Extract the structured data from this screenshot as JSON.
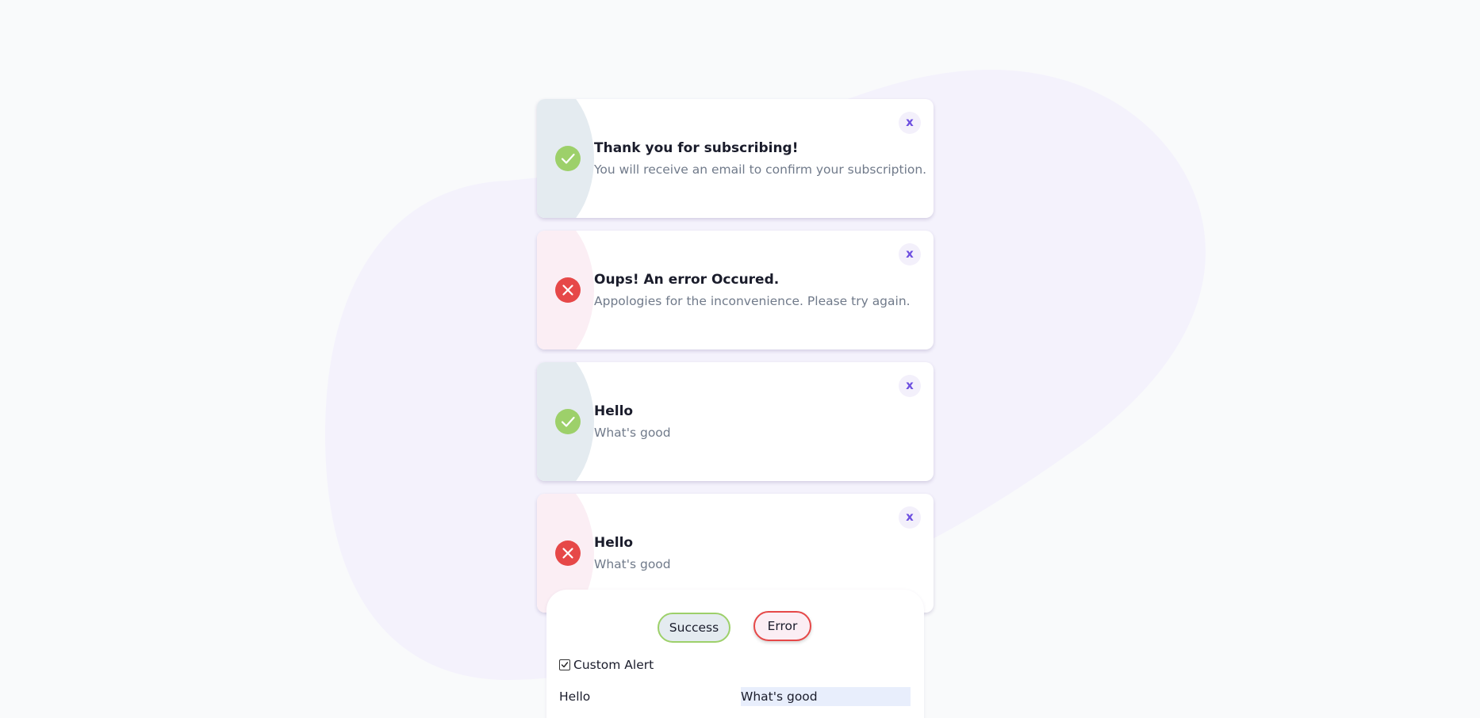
{
  "colors": {
    "background": "#f9fafb",
    "blob": "#f4f2fc",
    "success_icon": "#9dd06a",
    "success_side": "#e4ebf0",
    "error_icon": "#e64848",
    "error_side": "#fbeef4",
    "close_accent": "#6d4fe0"
  },
  "alerts": [
    {
      "type": "success",
      "icon": "check-icon",
      "title": "Thank you for subscribing!",
      "message": "You will receive an email to confirm your subscription.",
      "close_label": "x"
    },
    {
      "type": "error",
      "icon": "x-icon",
      "title": "Oups! An error Occured.",
      "message": "Appologies for the inconvenience. Please try again.",
      "close_label": "x"
    },
    {
      "type": "success",
      "icon": "check-icon",
      "title": "Hello",
      "message": "What's good",
      "close_label": "x"
    },
    {
      "type": "error",
      "icon": "x-icon",
      "title": "Hello",
      "message": "What's good",
      "close_label": "x"
    }
  ],
  "controls": {
    "success_button": "Success",
    "error_button": "Error",
    "custom_alert_label": "Custom Alert",
    "custom_alert_checked": true,
    "title_value": "Hello",
    "message_value": "What's good"
  }
}
